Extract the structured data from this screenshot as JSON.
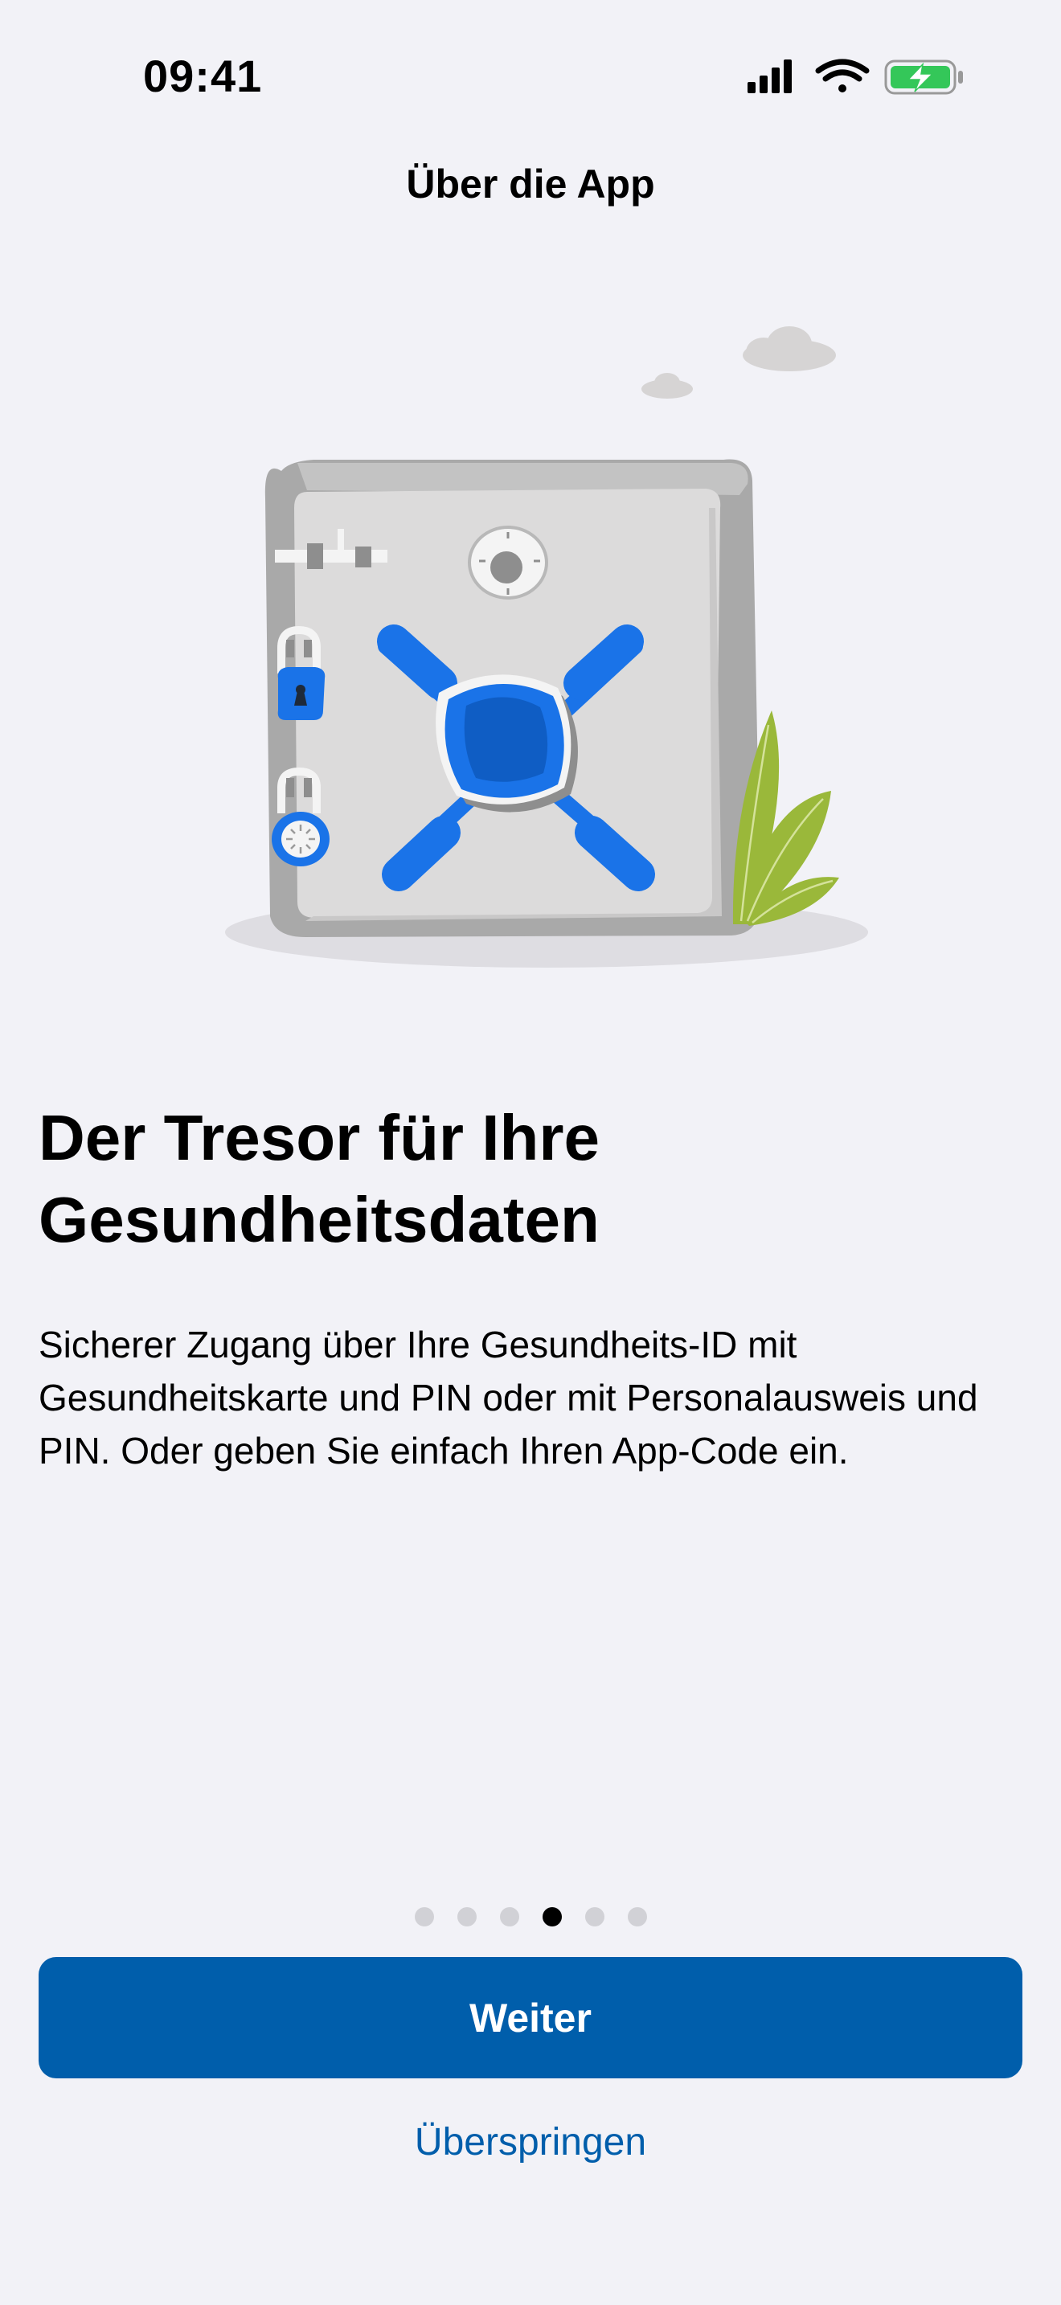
{
  "status_bar": {
    "time": "09:41",
    "icons": [
      "cellular-signal-icon",
      "wifi-icon",
      "battery-charging-icon"
    ]
  },
  "nav": {
    "title": "Über die App"
  },
  "illustration": {
    "icon": "safe-illustration"
  },
  "content": {
    "headline": "Der Tresor für Ihre Gesundheitsdaten",
    "body": "Sicherer Zugang über Ihre Gesundheits-ID mit Gesundheitskarte und PIN oder mit Personalausweis und PIN. Oder geben Sie einfach Ihren App-Code ein."
  },
  "pagination": {
    "total": 6,
    "current": 4
  },
  "actions": {
    "primary_label": "Weiter",
    "skip_label": "Überspringen"
  },
  "colors": {
    "background": "#F2F2F7",
    "primary": "#005EAB",
    "accent_blue": "#1A73E8",
    "battery_green": "#34C759",
    "plant_green": "#9AB83A"
  }
}
